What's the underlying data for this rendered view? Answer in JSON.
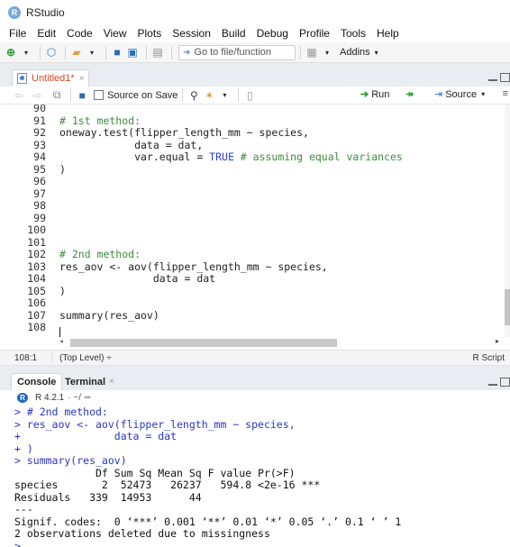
{
  "window": {
    "title": "RStudio",
    "logo_letter": "R"
  },
  "menu": [
    "File",
    "Edit",
    "Code",
    "View",
    "Plots",
    "Session",
    "Build",
    "Debug",
    "Profile",
    "Tools",
    "Help"
  ],
  "toolbar": {
    "goto_placeholder": "Go to file/function",
    "addins_label": "Addins"
  },
  "source_tab": {
    "label": "Untitled1*",
    "close": "×"
  },
  "editor_toolbar": {
    "source_on_save_label": "Source on Save",
    "run_label": "Run",
    "source_label": "Source"
  },
  "editor": {
    "lines": [
      {
        "n": "90",
        "text": ""
      },
      {
        "n": "91",
        "text": "# 1st method:",
        "type": "comment"
      },
      {
        "n": "92",
        "text": "oneway.test(flipper_length_mm ~ species,"
      },
      {
        "n": "93",
        "text": "            data = dat,"
      },
      {
        "n": "94",
        "pre": "            var.equal = ",
        "kw": "TRUE",
        "cm": " # assuming equal variances",
        "type": "mixed"
      },
      {
        "n": "95",
        "text": ")"
      },
      {
        "n": "96",
        "text": ""
      },
      {
        "n": "97",
        "text": ""
      },
      {
        "n": "98",
        "text": ""
      },
      {
        "n": "99",
        "text": ""
      },
      {
        "n": "100",
        "text": ""
      },
      {
        "n": "101",
        "text": ""
      },
      {
        "n": "102",
        "text": "# 2nd method:",
        "type": "comment"
      },
      {
        "n": "103",
        "text": "res_aov <- aov(flipper_length_mm ~ species,"
      },
      {
        "n": "104",
        "text": "               data = dat"
      },
      {
        "n": "105",
        "text": ")"
      },
      {
        "n": "106",
        "text": ""
      },
      {
        "n": "107",
        "text": "summary(res_aov)"
      },
      {
        "n": "108",
        "text": ""
      }
    ]
  },
  "status": {
    "position": "108:1",
    "scope": "(Top Level) ÷",
    "file_type": "R Script"
  },
  "console_tabs": {
    "console": "Console",
    "terminal": "Terminal",
    "close": "×"
  },
  "console_header": {
    "r_version": "R 4.2.1",
    "dir": "· ~/"
  },
  "console": {
    "lines": [
      {
        "text": "> # 2nd method:",
        "type": "input"
      },
      {
        "text": "> res_aov <- aov(flipper_length_mm ~ species,",
        "type": "input"
      },
      {
        "text": "+               data = dat",
        "type": "input"
      },
      {
        "text": "+ )",
        "type": "input"
      },
      {
        "text": "> summary(res_aov)",
        "type": "input"
      },
      {
        "text": "             Df Sum Sq Mean Sq F value Pr(>F)    ",
        "type": "output"
      },
      {
        "text": "species       2  52473   26237   594.8 <2e-16 ***",
        "type": "output"
      },
      {
        "text": "Residuals   339  14953      44                   ",
        "type": "output"
      },
      {
        "text": "---",
        "type": "output"
      },
      {
        "text": "Signif. codes:  0 ‘***’ 0.001 ‘**’ 0.01 ‘*’ 0.05 ‘.’ 0.1 ‘ ’ 1",
        "type": "output"
      },
      {
        "text": "2 observations deleted due to missingness",
        "type": "output"
      },
      {
        "text": ">",
        "type": "input"
      }
    ]
  },
  "colors": {
    "comment": "#3f8a3f",
    "keyword": "#2b3cd3",
    "console_input": "#2a35c4",
    "tab_modified": "#cc4b28"
  }
}
